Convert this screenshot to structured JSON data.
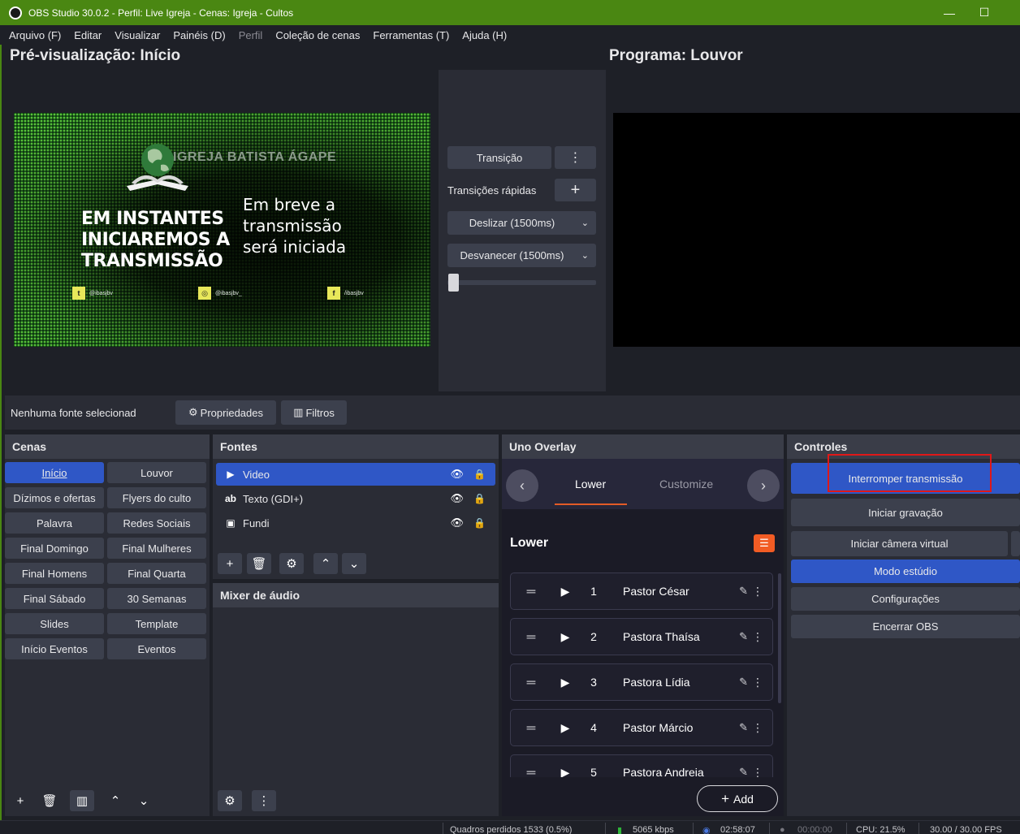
{
  "window": {
    "title": "OBS Studio 30.0.2 - Perfil: Live Igreja - Cenas: Igreja - Cultos"
  },
  "menu": {
    "arquivo": "Arquivo (F)",
    "editar": "Editar",
    "visualizar": "Visualizar",
    "paineis": "Painéis (D)",
    "perfil": "Perfil",
    "colecao": "Coleção de cenas",
    "ferramentas": "Ferramentas (T)",
    "ajuda": "Ajuda (H)"
  },
  "preview": {
    "title": "Pré-visualização: Início",
    "church_name": "IGREJA BATISTA ÁGAPE",
    "big_lines": [
      "EM INSTANTES",
      "INICIAREMOS A",
      "TRANSMISSÃO"
    ],
    "side_lines": [
      "Em breve a",
      "transmissão",
      "será iniciada"
    ],
    "socials": [
      {
        "icon": "twitter-icon",
        "glyph": "t",
        "handle": "@ibasjbv"
      },
      {
        "icon": "instagram-icon",
        "glyph": "◎",
        "handle": "@ibasjbv_"
      },
      {
        "icon": "facebook-icon",
        "glyph": "f",
        "handle": "/ibasjbv"
      }
    ]
  },
  "program": {
    "title": "Programa: Louvor"
  },
  "transitions": {
    "transition_button": "Transição",
    "quick_label": "Transições rápidas",
    "options": [
      "Deslizar (1500ms)",
      "Desvanecer (1500ms)"
    ],
    "slider_value": 0
  },
  "source_bar": {
    "status": "Nenhuma fonte selecionad",
    "properties": "Propriedades",
    "filters": "Filtros"
  },
  "scenes": {
    "title": "Cenas",
    "active": "Início",
    "items": [
      "Início",
      "Louvor",
      "Dízimos e ofertas",
      "Flyers do culto",
      "Palavra",
      "Redes Sociais",
      "Final Domingo",
      "Final Mulheres",
      "Final Homens",
      "Final Quarta",
      "Final Sábado",
      "30 Semanas",
      "Slides",
      "Template",
      "Início Eventos",
      "Eventos"
    ]
  },
  "sources": {
    "title": "Fontes",
    "items": [
      {
        "name": "Video",
        "icon": "play-icon",
        "active": true
      },
      {
        "name": "Texto (GDI+)",
        "icon": "text-icon",
        "active": false
      },
      {
        "name": "Fundi",
        "icon": "image-icon",
        "active": false
      }
    ]
  },
  "mixer": {
    "title": "Mixer de áudio"
  },
  "uno": {
    "title": "Uno Overlay",
    "tabs": [
      "Lower",
      "Customize"
    ],
    "active_tab": "Lower",
    "section": "Lower",
    "items": [
      {
        "num": "1",
        "name": "Pastor César"
      },
      {
        "num": "2",
        "name": "Pastora Thaísa"
      },
      {
        "num": "3",
        "name": "Pastora Lídia"
      },
      {
        "num": "4",
        "name": "Pastor Márcio"
      },
      {
        "num": "5",
        "name": "Pastora Andreia"
      }
    ],
    "add_label": "Add"
  },
  "controls": {
    "title": "Controles",
    "stop_stream": "Interromper transmissão",
    "start_record": "Iniciar gravação",
    "virtual_cam": "Iniciar câmera virtual",
    "studio_mode": "Modo estúdio",
    "settings": "Configurações",
    "exit": "Encerrar OBS"
  },
  "status": {
    "dropped": "Quadros perdidos 1533 (0.5%)",
    "bitrate": "5065 kbps",
    "stream_time": "02:58:07",
    "rec_time": "00:00:00",
    "cpu": "CPU: 21.5%",
    "fps": "30.00 / 30.00 FPS"
  },
  "colors": {
    "accent": "#2f57c6",
    "titlebar": "#4a8712",
    "uno_accent": "#f25c24",
    "highlight_box": "#e01818"
  }
}
